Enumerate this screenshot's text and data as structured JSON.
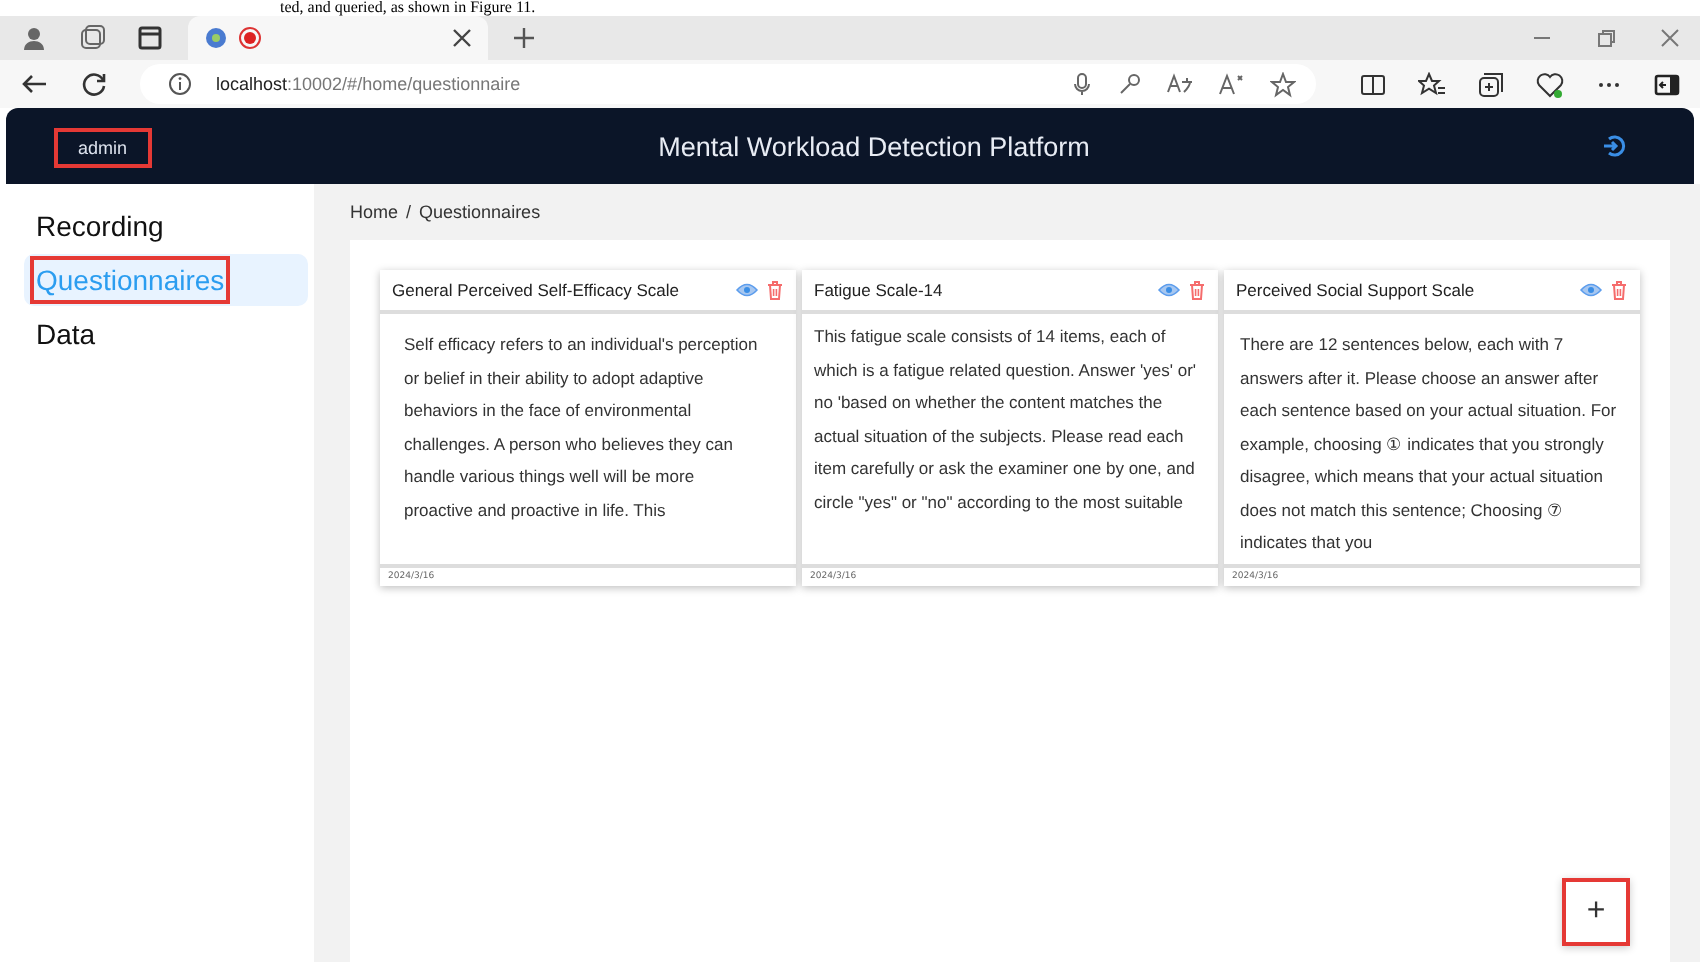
{
  "document_text": "ted, and queried, as shown in Figure 11.",
  "browser": {
    "tabs": [
      {
        "selected": true
      }
    ],
    "url_host": "localhost",
    "url_rest": ":10002/#/home/questionnaire"
  },
  "header": {
    "user": {
      "label": "admin",
      "highlighted": true
    },
    "title": "Mental Workload Detection Platform"
  },
  "sidebar": {
    "items": [
      {
        "label": "Recording",
        "selected": false,
        "highlighted": false
      },
      {
        "label": "Questionnaires",
        "selected": true,
        "highlighted": true
      },
      {
        "label": "Data",
        "selected": false,
        "highlighted": false
      }
    ]
  },
  "breadcrumb": [
    "Home",
    "/",
    "Questionnaires"
  ],
  "cards": [
    {
      "title": "General Perceived Self-Efficacy Scale",
      "text": "Self efficacy refers to an individual's perception or belief in their ability to adopt adaptive behaviors in the face of environmental challenges. A person who believes they can handle various things well will be more proactive and proactive in life. This",
      "date": "2024/3/16"
    },
    {
      "title": "Fatigue Scale-14",
      "text": "This fatigue scale consists of 14 items, each of which is a fatigue related question. Answer 'yes' or' no 'based on whether the content matches the actual situation of the subjects. Please read each item carefully or ask the examiner one by one, and circle \"yes\" or \"no\" according to the most suitable",
      "date": "2024/3/16"
    },
    {
      "title": "Perceived Social Support Scale",
      "text": "There are 12 sentences below, each with 7 answers after it. Please choose an answer after each sentence based on your actual situation. For example, choosing ① indicates that you strongly disagree, which means that your actual situation does not match this sentence; Choosing ⑦ indicates that you",
      "date": "2024/3/16"
    }
  ],
  "add_button": {
    "label": "+",
    "highlighted": true
  }
}
